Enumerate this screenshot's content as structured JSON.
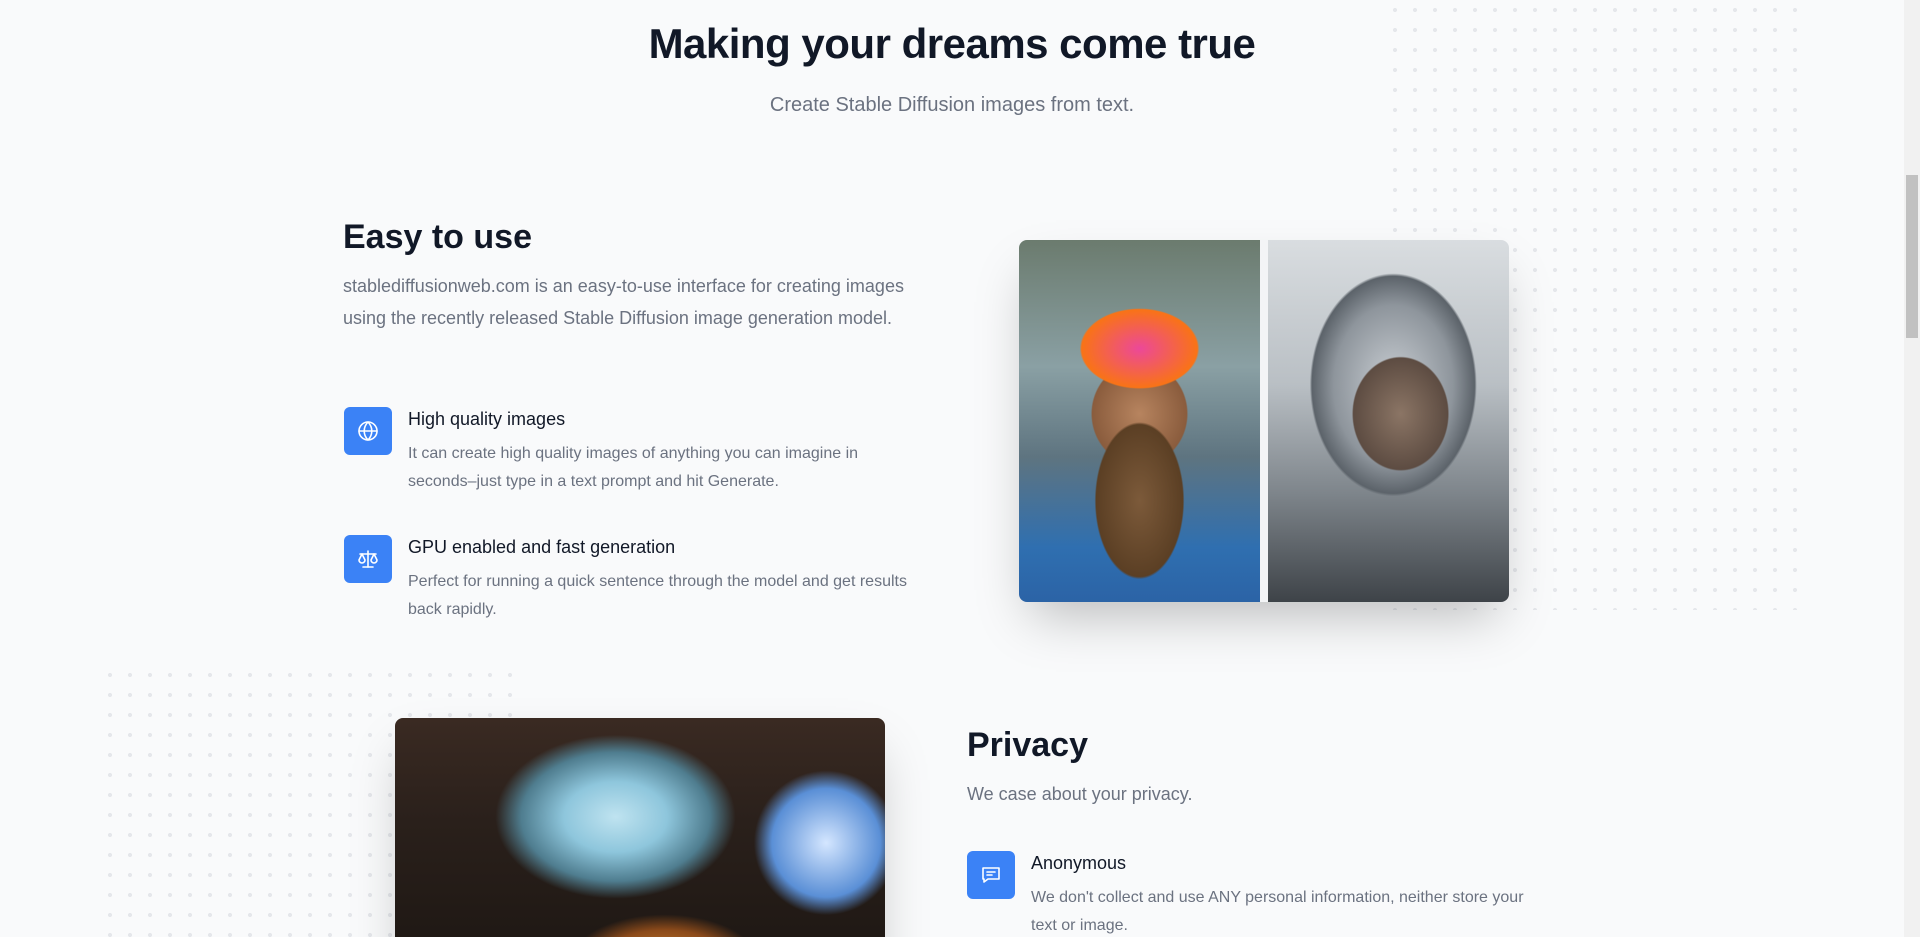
{
  "hero": {
    "title": "Making your dreams come true",
    "subtitle": "Create Stable Diffusion images from text."
  },
  "easy": {
    "title": "Easy to use",
    "description": "stablediffusionweb.com is an easy-to-use interface for creating images using the recently released Stable Diffusion image generation model.",
    "features": [
      {
        "icon": "globe-icon",
        "title": "High quality images",
        "description": "It can create high quality images of anything you can imagine in seconds–just type in a text prompt and hit Generate."
      },
      {
        "icon": "scale-icon",
        "title": "GPU enabled and fast generation",
        "description": "Perfect for running a quick sentence through the model and get results back rapidly."
      }
    ]
  },
  "privacy": {
    "title": "Privacy",
    "description": "We case about your privacy.",
    "features": [
      {
        "icon": "chat-icon",
        "title": "Anonymous",
        "description": "We don't collect and use ANY personal information, neither store your text or image."
      }
    ]
  },
  "colors": {
    "accent": "#3b82f6",
    "heading": "#111827",
    "body": "#6b7280",
    "background": "#f9fafb"
  }
}
